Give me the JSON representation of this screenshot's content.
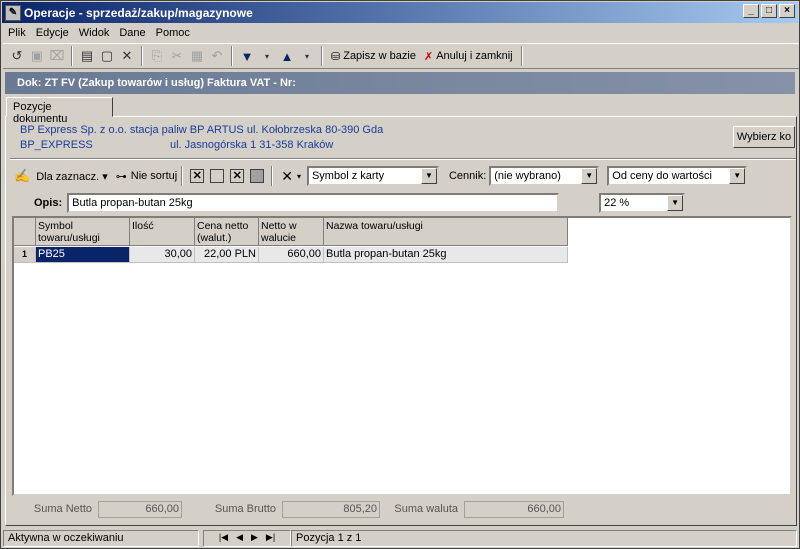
{
  "window": {
    "title": "Operacje - sprzedaż/zakup/magazynowe"
  },
  "menu": [
    "Plik",
    "Edycje",
    "Widok",
    "Dane",
    "Pomoc"
  ],
  "toolbar": {
    "save_label": "Zapisz w bazie",
    "cancel_label": "Anuluj i zamknij"
  },
  "document": {
    "header": "Dok: ZT FV (Zakup towarów i usług)  Faktura VAT  -  Nr:"
  },
  "tabs": [
    "Pozycje dokumentu"
  ],
  "contractor": {
    "line1_left": "BP Express Sp. z o.o. stacja paliw BP ARTUS ul. Kołobrzeska 80-390 Gda",
    "line2_left": "BP_EXPRESS",
    "line2_right": "ul. Jasnogórska 1 31-358 Kraków",
    "choose_button": "Wybierz ko"
  },
  "row_toolbar": {
    "select_label": "Dla zaznacz.",
    "nosort_label": "Nie sortuj",
    "symbol_combo": "Symbol z karty",
    "pricelist_label": "Cennik:",
    "pricelist_combo": "(nie wybrano)",
    "calc_combo": "Od ceny do wartości"
  },
  "opis": {
    "label": "Opis:",
    "value": "Butla propan-butan 25kg",
    "vat": "22 %"
  },
  "grid": {
    "headers": [
      "Symbol towaru/usługi",
      "Ilość",
      "Cena netto (walut.)",
      "Netto w walucie",
      "Nazwa towaru/usługi"
    ],
    "rows": [
      {
        "index": "1",
        "symbol": "PB25",
        "qty": "30,00",
        "price": "22,00 PLN",
        "net": "660,00",
        "name": "Butla propan-butan 25kg"
      }
    ]
  },
  "sums": {
    "netto_label": "Suma Netto",
    "netto": "660,00",
    "brutto_label": "Suma Brutto",
    "brutto": "805,20",
    "waluta_label": "Suma waluta",
    "waluta": "660,00"
  },
  "status": {
    "state": "Aktywna w oczekiwaniu",
    "position": "Pozycja 1 z 1"
  }
}
